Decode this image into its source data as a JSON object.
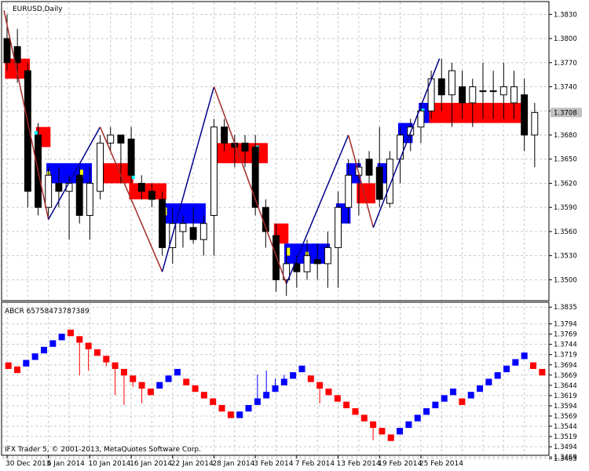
{
  "window": {
    "symbol_label": "EURUSD,Daily",
    "indicator_label": "ABCR 65758473787389",
    "copyright": "IFX Trader 5, © 2001-2013, MetaQuotes Software Corp.",
    "current_price": "1.3708"
  },
  "colors": {
    "bull": "#0000ff",
    "bear": "#ff0000",
    "zigzag_up": "#00008b",
    "zigzag_down": "#a52a2a",
    "marker_yellow": "#ffff00",
    "marker_cyan": "#00ffff",
    "grid": "#c8c8c8",
    "price_box": "#c0c0c0"
  },
  "chart_data": [
    {
      "type": "candlestick",
      "title": "EURUSD,Daily",
      "ylim": [
        1.3475,
        1.3845
      ],
      "y_ticks": [
        "1.3830",
        "1.3800",
        "1.3770",
        "1.3740",
        "1.3710",
        "1.3680",
        "1.3650",
        "1.3620",
        "1.3590",
        "1.3560",
        "1.3530",
        "1.3500"
      ],
      "x_ticks": [
        "30 Dec 2013",
        "6 Jan 2014",
        "10 Jan 2014",
        "16 Jan 2014",
        "22 Jan 2014",
        "28 Jan 2014",
        "3 Feb 2014",
        "7 Feb 2014",
        "13 Feb 2014",
        "19 Feb 2014",
        "25 Feb 2014"
      ],
      "candles": [
        {
          "o": 1.38,
          "h": 1.383,
          "l": 1.376,
          "c": 1.377
        },
        {
          "o": 1.379,
          "h": 1.3812,
          "l": 1.3745,
          "c": 1.377
        },
        {
          "o": 1.376,
          "h": 1.377,
          "l": 1.359,
          "c": 1.361
        },
        {
          "o": 1.368,
          "h": 1.3695,
          "l": 1.358,
          "c": 1.359
        },
        {
          "o": 1.359,
          "h": 1.364,
          "l": 1.3575,
          "c": 1.363
        },
        {
          "o": 1.362,
          "h": 1.364,
          "l": 1.359,
          "c": 1.361
        },
        {
          "o": 1.361,
          "h": 1.363,
          "l": 1.355,
          "c": 1.362
        },
        {
          "o": 1.363,
          "h": 1.364,
          "l": 1.357,
          "c": 1.358
        },
        {
          "o": 1.358,
          "h": 1.364,
          "l": 1.355,
          "c": 1.362
        },
        {
          "o": 1.361,
          "h": 1.368,
          "l": 1.36,
          "c": 1.367
        },
        {
          "o": 1.367,
          "h": 1.369,
          "l": 1.366,
          "c": 1.368
        },
        {
          "o": 1.368,
          "h": 1.367,
          "l": 1.362,
          "c": 1.367
        },
        {
          "o": 1.3675,
          "h": 1.369,
          "l": 1.362,
          "c": 1.363
        },
        {
          "o": 1.362,
          "h": 1.363,
          "l": 1.36,
          "c": 1.361
        },
        {
          "o": 1.361,
          "h": 1.362,
          "l": 1.359,
          "c": 1.36
        },
        {
          "o": 1.36,
          "h": 1.361,
          "l": 1.353,
          "c": 1.354
        },
        {
          "o": 1.354,
          "h": 1.359,
          "l": 1.352,
          "c": 1.357
        },
        {
          "o": 1.356,
          "h": 1.358,
          "l": 1.354,
          "c": 1.357
        },
        {
          "o": 1.3565,
          "h": 1.359,
          "l": 1.3545,
          "c": 1.355
        },
        {
          "o": 1.355,
          "h": 1.358,
          "l": 1.353,
          "c": 1.357
        },
        {
          "o": 1.358,
          "h": 1.37,
          "l": 1.353,
          "c": 1.369
        },
        {
          "o": 1.369,
          "h": 1.37,
          "l": 1.366,
          "c": 1.367
        },
        {
          "o": 1.367,
          "h": 1.368,
          "l": 1.364,
          "c": 1.3665
        },
        {
          "o": 1.367,
          "h": 1.368,
          "l": 1.364,
          "c": 1.366
        },
        {
          "o": 1.3665,
          "h": 1.368,
          "l": 1.358,
          "c": 1.359
        },
        {
          "o": 1.359,
          "h": 1.36,
          "l": 1.354,
          "c": 1.356
        },
        {
          "o": 1.3555,
          "h": 1.357,
          "l": 1.3485,
          "c": 1.35
        },
        {
          "o": 1.35,
          "h": 1.354,
          "l": 1.348,
          "c": 1.352
        },
        {
          "o": 1.352,
          "h": 1.353,
          "l": 1.349,
          "c": 1.351
        },
        {
          "o": 1.351,
          "h": 1.355,
          "l": 1.35,
          "c": 1.353
        },
        {
          "o": 1.3525,
          "h": 1.3545,
          "l": 1.35,
          "c": 1.352
        },
        {
          "o": 1.352,
          "h": 1.356,
          "l": 1.349,
          "c": 1.354
        },
        {
          "o": 1.354,
          "h": 1.361,
          "l": 1.349,
          "c": 1.359
        },
        {
          "o": 1.359,
          "h": 1.365,
          "l": 1.357,
          "c": 1.363
        },
        {
          "o": 1.363,
          "h": 1.365,
          "l": 1.358,
          "c": 1.364
        },
        {
          "o": 1.365,
          "h": 1.366,
          "l": 1.362,
          "c": 1.363
        },
        {
          "o": 1.364,
          "h": 1.369,
          "l": 1.359,
          "c": 1.36
        },
        {
          "o": 1.3595,
          "h": 1.366,
          "l": 1.359,
          "c": 1.365
        },
        {
          "o": 1.365,
          "h": 1.369,
          "l": 1.362,
          "c": 1.368
        },
        {
          "o": 1.368,
          "h": 1.37,
          "l": 1.366,
          "c": 1.369
        },
        {
          "o": 1.369,
          "h": 1.372,
          "l": 1.367,
          "c": 1.371
        },
        {
          "o": 1.371,
          "h": 1.376,
          "l": 1.37,
          "c": 1.375
        },
        {
          "o": 1.375,
          "h": 1.3775,
          "l": 1.371,
          "c": 1.373
        },
        {
          "o": 1.373,
          "h": 1.377,
          "l": 1.369,
          "c": 1.376
        },
        {
          "o": 1.374,
          "h": 1.376,
          "l": 1.37,
          "c": 1.372
        },
        {
          "o": 1.372,
          "h": 1.375,
          "l": 1.369,
          "c": 1.374
        },
        {
          "o": 1.3735,
          "h": 1.377,
          "l": 1.37,
          "c": 1.3735
        },
        {
          "o": 1.3735,
          "h": 1.376,
          "l": 1.37,
          "c": 1.3735
        },
        {
          "o": 1.373,
          "h": 1.377,
          "l": 1.37,
          "c": 1.374
        },
        {
          "o": 1.372,
          "h": 1.376,
          "l": 1.37,
          "c": 1.374
        },
        {
          "o": 1.373,
          "h": 1.375,
          "l": 1.366,
          "c": 1.368
        },
        {
          "o": 1.368,
          "h": 1.372,
          "l": 1.364,
          "c": 1.3708
        }
      ],
      "zigzag": [
        {
          "i": -0.3,
          "p": 1.3835
        },
        {
          "i": 4,
          "p": 1.3575
        },
        {
          "i": 9,
          "p": 1.369
        },
        {
          "i": 15,
          "p": 1.351
        },
        {
          "i": 20,
          "p": 1.374
        },
        {
          "i": 27,
          "p": 1.3495
        },
        {
          "i": 33,
          "p": 1.368
        },
        {
          "i": 35.4,
          "p": 1.3565
        },
        {
          "i": 41.8,
          "p": 1.3775
        }
      ],
      "boxes": [
        {
          "i0": -0.2,
          "i1": 2.2,
          "hi": 1.3775,
          "lo": 1.375,
          "color": "bear"
        },
        {
          "i0": 2.8,
          "i1": 4.2,
          "hi": 1.369,
          "lo": 1.3665,
          "color": "bear"
        },
        {
          "i0": 3.8,
          "i1": 8.2,
          "hi": 1.3645,
          "lo": 1.362,
          "color": "bull"
        },
        {
          "i0": 8.8,
          "i1": 12.2,
          "hi": 1.3645,
          "lo": 1.362,
          "color": "bear"
        },
        {
          "i0": 11.8,
          "i1": 15.4,
          "hi": 1.362,
          "lo": 1.36,
          "color": "bear"
        },
        {
          "i0": 14.8,
          "i1": 19.2,
          "hi": 1.3595,
          "lo": 1.357,
          "color": "bull"
        },
        {
          "i0": 19.8,
          "i1": 25.2,
          "hi": 1.367,
          "lo": 1.3645,
          "color": "bear"
        },
        {
          "i0": 25.8,
          "i1": 27.2,
          "hi": 1.357,
          "lo": 1.3545,
          "color": "bear"
        },
        {
          "i0": 26.8,
          "i1": 31.2,
          "hi": 1.3545,
          "lo": 1.352,
          "color": "bull"
        },
        {
          "i0": 31.8,
          "i1": 33.2,
          "hi": 1.3595,
          "lo": 1.357,
          "color": "bull"
        },
        {
          "i0": 32.8,
          "i1": 34.2,
          "hi": 1.3645,
          "lo": 1.362,
          "color": "bull"
        },
        {
          "i0": 33.8,
          "i1": 35.6,
          "hi": 1.362,
          "lo": 1.3595,
          "color": "bear"
        },
        {
          "i0": 35.8,
          "i1": 37.2,
          "hi": 1.3645,
          "lo": 1.362,
          "color": "bull"
        },
        {
          "i0": 37.8,
          "i1": 39.2,
          "hi": 1.3695,
          "lo": 1.367,
          "color": "bull"
        },
        {
          "i0": 39.8,
          "i1": 41.2,
          "hi": 1.372,
          "lo": 1.3695,
          "color": "bull"
        },
        {
          "i0": 40.8,
          "i1": 49.8,
          "hi": 1.372,
          "lo": 1.3695,
          "color": "bear"
        }
      ],
      "markers": [
        {
          "i": 2.8,
          "p": 1.368,
          "color": "marker_cyan"
        },
        {
          "i": 4.0,
          "p": 1.363,
          "color": "marker_yellow"
        },
        {
          "i": 7.2,
          "p": 1.3632,
          "color": "marker_yellow"
        },
        {
          "i": 12.2,
          "p": 1.363,
          "color": "marker_cyan"
        },
        {
          "i": 15.3,
          "p": 1.3585,
          "color": "marker_yellow"
        },
        {
          "i": 24.2,
          "p": 1.3662,
          "color": "marker_cyan"
        },
        {
          "i": 27.2,
          "p": 1.3535,
          "color": "marker_yellow"
        },
        {
          "i": 29.0,
          "p": 1.353,
          "color": "marker_yellow"
        },
        {
          "i": 40.2,
          "p": 1.3708,
          "color": "marker_cyan"
        },
        {
          "i": 49.8,
          "p": 1.3705,
          "color": "marker_cyan"
        }
      ]
    },
    {
      "type": "bar",
      "title": "ABCR 65758473787389",
      "ylim": [
        1.3475,
        1.3845
      ],
      "y_ticks": [
        "1.3835",
        "1.3794",
        "1.3769",
        "1.3744",
        "1.3719",
        "1.3694",
        "1.3669",
        "1.3644",
        "1.3619",
        "1.3594",
        "1.3569",
        "1.3544",
        "1.3519",
        "1.3494",
        "1.3469",
        "1.3465"
      ],
      "bricks": [
        {
          "top": 1.37,
          "bot": 1.3684,
          "wick": 1.37,
          "color": "bear"
        },
        {
          "top": 1.369,
          "bot": 1.3674,
          "wick": 1.369,
          "color": "bear"
        },
        {
          "top": 1.3706,
          "bot": 1.369,
          "wick": 1.3706,
          "color": "bull"
        },
        {
          "top": 1.3722,
          "bot": 1.3706,
          "wick": 1.3722,
          "color": "bull"
        },
        {
          "top": 1.3738,
          "bot": 1.3722,
          "wick": 1.3738,
          "color": "bull"
        },
        {
          "top": 1.3754,
          "bot": 1.3738,
          "wick": 1.3754,
          "color": "bull"
        },
        {
          "top": 1.377,
          "bot": 1.3754,
          "wick": 1.377,
          "color": "bull"
        },
        {
          "top": 1.378,
          "bot": 1.3764,
          "wick": 1.378,
          "color": "bear"
        },
        {
          "top": 1.3764,
          "bot": 1.3748,
          "wick": 1.3668,
          "color": "bear"
        },
        {
          "top": 1.3748,
          "bot": 1.3732,
          "wick": 1.368,
          "color": "bear"
        },
        {
          "top": 1.3732,
          "bot": 1.3716,
          "wick": 1.3716,
          "color": "bear"
        },
        {
          "top": 1.3716,
          "bot": 1.37,
          "wick": 1.369,
          "color": "bear"
        },
        {
          "top": 1.37,
          "bot": 1.3684,
          "wick": 1.362,
          "color": "bear"
        },
        {
          "top": 1.3684,
          "bot": 1.3668,
          "wick": 1.3596,
          "color": "bear"
        },
        {
          "top": 1.3668,
          "bot": 1.3652,
          "wick": 1.364,
          "color": "bear"
        },
        {
          "top": 1.3652,
          "bot": 1.3636,
          "wick": 1.36,
          "color": "bear"
        },
        {
          "top": 1.3636,
          "bot": 1.362,
          "wick": 1.362,
          "color": "bear"
        },
        {
          "top": 1.3652,
          "bot": 1.3636,
          "wick": 1.3636,
          "color": "bull"
        },
        {
          "top": 1.3668,
          "bot": 1.3652,
          "wick": 1.3652,
          "color": "bull"
        },
        {
          "top": 1.3684,
          "bot": 1.3668,
          "wick": 1.3668,
          "color": "bull"
        },
        {
          "top": 1.366,
          "bot": 1.3644,
          "wick": 1.3644,
          "color": "bear"
        },
        {
          "top": 1.3644,
          "bot": 1.3628,
          "wick": 1.3628,
          "color": "bear"
        },
        {
          "top": 1.3628,
          "bot": 1.3612,
          "wick": 1.3612,
          "color": "bear"
        },
        {
          "top": 1.3612,
          "bot": 1.3596,
          "wick": 1.3596,
          "color": "bear"
        },
        {
          "top": 1.3596,
          "bot": 1.358,
          "wick": 1.358,
          "color": "bear"
        },
        {
          "top": 1.358,
          "bot": 1.3564,
          "wick": 1.3564,
          "color": "bear"
        },
        {
          "top": 1.358,
          "bot": 1.3564,
          "wick": 1.3564,
          "color": "bull"
        },
        {
          "top": 1.3596,
          "bot": 1.358,
          "wick": 1.358,
          "color": "bull"
        },
        {
          "top": 1.3612,
          "bot": 1.3596,
          "wick": 1.367,
          "color": "bull"
        },
        {
          "top": 1.3628,
          "bot": 1.3612,
          "wick": 1.368,
          "color": "bull"
        },
        {
          "top": 1.3644,
          "bot": 1.3628,
          "wick": 1.366,
          "color": "bull"
        },
        {
          "top": 1.366,
          "bot": 1.3644,
          "wick": 1.367,
          "color": "bull"
        },
        {
          "top": 1.3676,
          "bot": 1.366,
          "wick": 1.3676,
          "color": "bull"
        },
        {
          "top": 1.3692,
          "bot": 1.3676,
          "wick": 1.3692,
          "color": "bull"
        },
        {
          "top": 1.3668,
          "bot": 1.3652,
          "wick": 1.3652,
          "color": "bear"
        },
        {
          "top": 1.3652,
          "bot": 1.3636,
          "wick": 1.36,
          "color": "bear"
        },
        {
          "top": 1.3636,
          "bot": 1.362,
          "wick": 1.362,
          "color": "bear"
        },
        {
          "top": 1.362,
          "bot": 1.3604,
          "wick": 1.3604,
          "color": "bear"
        },
        {
          "top": 1.3604,
          "bot": 1.3588,
          "wick": 1.3588,
          "color": "bear"
        },
        {
          "top": 1.3588,
          "bot": 1.3572,
          "wick": 1.3572,
          "color": "bear"
        },
        {
          "top": 1.3572,
          "bot": 1.3556,
          "wick": 1.3556,
          "color": "bear"
        },
        {
          "top": 1.3556,
          "bot": 1.354,
          "wick": 1.351,
          "color": "bear"
        },
        {
          "top": 1.354,
          "bot": 1.3524,
          "wick": 1.3524,
          "color": "bear"
        },
        {
          "top": 1.3524,
          "bot": 1.3508,
          "wick": 1.3508,
          "color": "bear"
        },
        {
          "top": 1.354,
          "bot": 1.3524,
          "wick": 1.3524,
          "color": "bull"
        },
        {
          "top": 1.3556,
          "bot": 1.354,
          "wick": 1.354,
          "color": "bull"
        },
        {
          "top": 1.3572,
          "bot": 1.3556,
          "wick": 1.3556,
          "color": "bull"
        },
        {
          "top": 1.3588,
          "bot": 1.3572,
          "wick": 1.3572,
          "color": "bull"
        },
        {
          "top": 1.3604,
          "bot": 1.3588,
          "wick": 1.3588,
          "color": "bull"
        },
        {
          "top": 1.362,
          "bot": 1.3604,
          "wick": 1.3604,
          "color": "bull"
        },
        {
          "top": 1.3636,
          "bot": 1.362,
          "wick": 1.362,
          "color": "bull"
        },
        {
          "top": 1.3612,
          "bot": 1.3596,
          "wick": 1.3596,
          "color": "bear"
        },
        {
          "top": 1.3628,
          "bot": 1.3612,
          "wick": 1.3612,
          "color": "bull"
        },
        {
          "top": 1.3644,
          "bot": 1.3628,
          "wick": 1.3628,
          "color": "bull"
        },
        {
          "top": 1.366,
          "bot": 1.3644,
          "wick": 1.3644,
          "color": "bull"
        },
        {
          "top": 1.3676,
          "bot": 1.366,
          "wick": 1.3676,
          "color": "bull"
        },
        {
          "top": 1.3692,
          "bot": 1.3676,
          "wick": 1.3692,
          "color": "bull"
        },
        {
          "top": 1.3708,
          "bot": 1.3692,
          "wick": 1.3708,
          "color": "bull"
        },
        {
          "top": 1.3724,
          "bot": 1.3708,
          "wick": 1.3724,
          "color": "bull"
        },
        {
          "top": 1.37,
          "bot": 1.3684,
          "wick": 1.3684,
          "color": "bear"
        },
        {
          "top": 1.3684,
          "bot": 1.3668,
          "wick": 1.3668,
          "color": "bear"
        }
      ]
    }
  ]
}
